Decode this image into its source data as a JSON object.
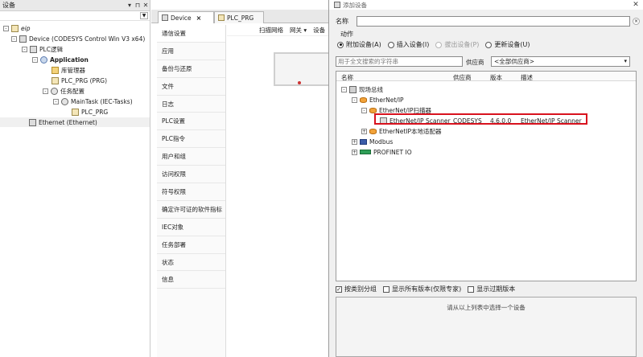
{
  "devices_pane": {
    "title": "设备",
    "buttons": [
      "▾",
      "⊓",
      "✕"
    ],
    "tree": {
      "project": "eip",
      "device": "Device (CODESYS Control Win V3 x64)",
      "plc_logic": "PLC逻辑",
      "application": "Application",
      "library_manager": "库管理器",
      "plc_prg": "PLC_PRG (PRG)",
      "task_config": "任务配置",
      "main_task": "MainTask (IEC-Tasks)",
      "main_task_prg": "PLC_PRG",
      "ethernet": "Ethernet (Ethernet)"
    }
  },
  "editor": {
    "tabs": [
      {
        "label": "Device",
        "closable": true
      },
      {
        "label": "PLC_PRG",
        "closable": false
      }
    ],
    "nav_items": [
      "通信设置",
      "应用",
      "备份与还原",
      "文件",
      "日志",
      "PLC设置",
      "PLC指令",
      "用户和组",
      "访问权限",
      "符号权限",
      "确定许可证的软件指标",
      "IEC对象",
      "任务部署",
      "状态",
      "信息"
    ],
    "toolbar": [
      "扫描网络",
      "网关 ▾",
      "设备"
    ]
  },
  "dialog": {
    "title": "添加设备",
    "name_label": "名称",
    "name_value": "",
    "action_label": "动作",
    "actions": [
      {
        "label": "附加设备(A)",
        "checked": true,
        "disabled": false
      },
      {
        "label": "插入设备(I)",
        "checked": false,
        "disabled": false
      },
      {
        "label": "拔出设备(P)",
        "checked": false,
        "disabled": true
      },
      {
        "label": "更新设备(U)",
        "checked": false,
        "disabled": false
      }
    ],
    "search_placeholder": "用于全文搜索的字符串",
    "vendor_label": "供应商",
    "vendor_value": "<全部供应商>",
    "list_columns": [
      "名称",
      "供应商",
      "版本",
      "描述"
    ],
    "list": {
      "fieldbus": "现场总线",
      "ethernet_ip": "EtherNet/IP",
      "scanner_group": "EtherNet/IP扫描器",
      "scanner": {
        "name": "EtherNet/IP Scanner",
        "vendor": "CODESYS",
        "version": "4.6.0.0",
        "description": "EtherNet/IP Scanner"
      },
      "local_adapter": "EtherNetIP本地适配器",
      "modbus": "Modbus",
      "profinet": "PROFINET IO"
    },
    "options": [
      {
        "label": "按类别分组",
        "checked": true
      },
      {
        "label": "显示所有版本(仅限专家)",
        "checked": false
      },
      {
        "label": "显示过期版本",
        "checked": false
      }
    ],
    "info_text": "请从以上列表中选择一个设备"
  }
}
